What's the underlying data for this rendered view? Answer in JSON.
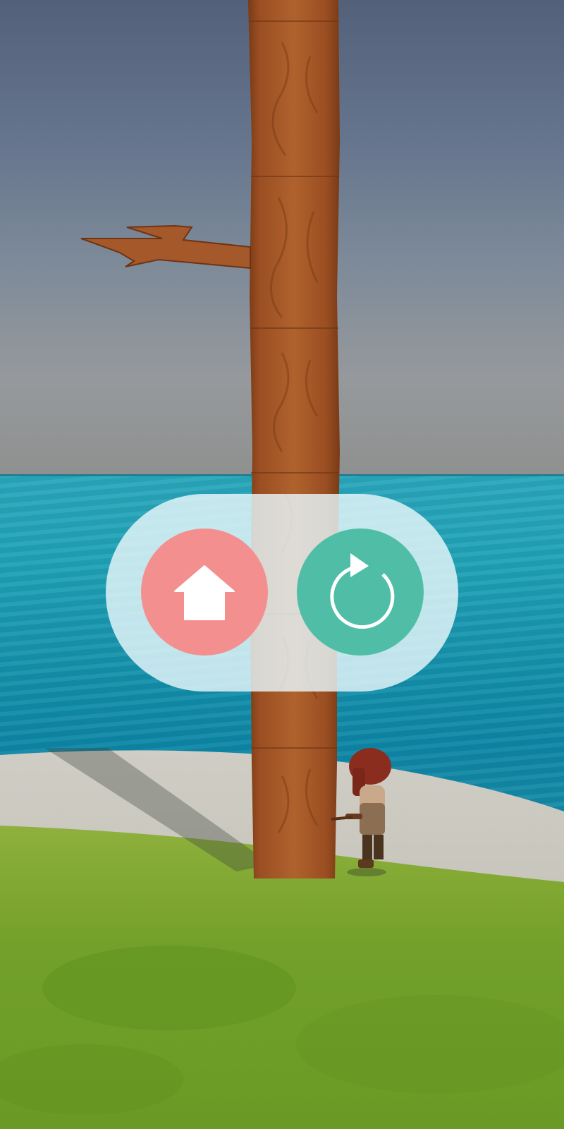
{
  "game": {
    "state": "game-over",
    "scene": "island-tree-chopping"
  },
  "overlay": {
    "buttons": [
      {
        "id": "home",
        "icon": "home-icon",
        "color": "#f3908f"
      },
      {
        "id": "restart",
        "icon": "restart-icon",
        "color": "#50bea6"
      }
    ]
  },
  "colors": {
    "panel": "#e8f6fa",
    "sky_top": "#536079",
    "sea": "#1592ac",
    "sand": "#c8c6bd",
    "grass": "#7aa52e",
    "trunk": "#9a4e22"
  }
}
